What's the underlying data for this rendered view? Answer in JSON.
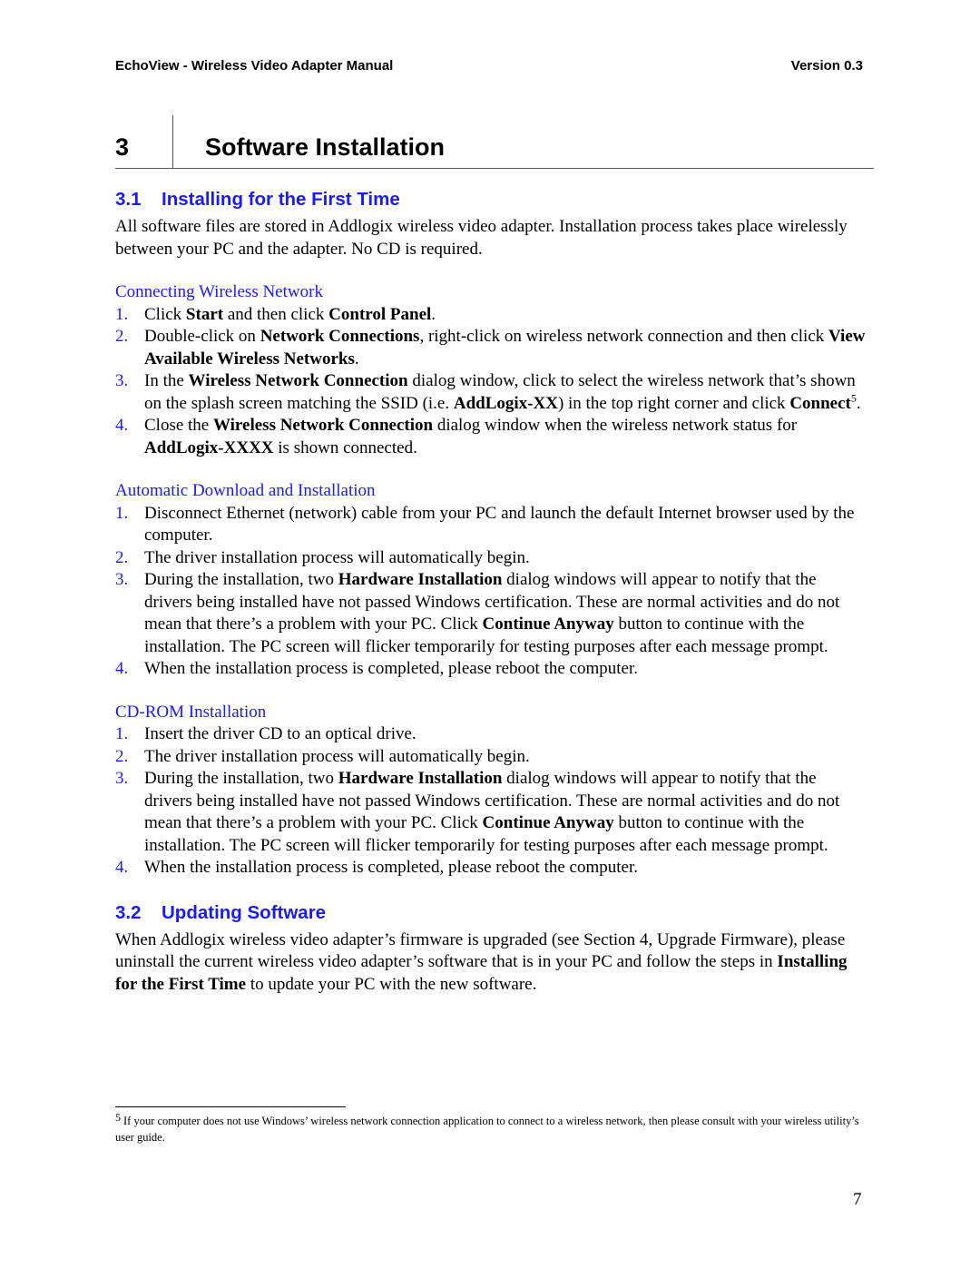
{
  "header": {
    "title": "EchoView - Wireless Video Adapter Manual",
    "version": "Version 0.3"
  },
  "chapter": {
    "number": "3",
    "title": "Software Installation"
  },
  "section1": {
    "number": "3.1",
    "title": "Installing for the First Time",
    "intro": "All software files are stored in Addlogix wireless video adapter.  Installation process takes place wirelessly between your PC and the adapter.  No CD is required.",
    "subsections": [
      {
        "title": "Connecting Wireless Network",
        "items": [
          {
            "num": "1.",
            "parts": [
              [
                "Click ",
                false
              ],
              [
                "Start",
                true
              ],
              [
                " and then click ",
                false
              ],
              [
                "Control Panel",
                true
              ],
              [
                ".",
                false
              ]
            ]
          },
          {
            "num": "2.",
            "parts": [
              [
                "Double-click on ",
                false
              ],
              [
                "Network Connections",
                true
              ],
              [
                ", right-click on wireless network connection and then click ",
                false
              ],
              [
                "View Available Wireless Networks",
                true
              ],
              [
                ".",
                false
              ]
            ]
          },
          {
            "num": "3.",
            "parts": [
              [
                "In the ",
                false
              ],
              [
                "Wireless Network Connection",
                true
              ],
              [
                " dialog window, click to select the wireless network that’s shown on the splash screen matching the SSID (i.e. ",
                false
              ],
              [
                "AddLogix-XX",
                true
              ],
              [
                ") in the top right corner and click ",
                false
              ],
              [
                "Connect",
                true
              ],
              [
                "5",
                "sup"
              ],
              [
                ".",
                false
              ]
            ]
          },
          {
            "num": "4.",
            "parts": [
              [
                "Close the ",
                false
              ],
              [
                "Wireless Network Connection",
                true
              ],
              [
                " dialog window when the wireless network status for ",
                false
              ],
              [
                "AddLogix-XXXX",
                true
              ],
              [
                " is shown connected.",
                false
              ]
            ]
          }
        ]
      },
      {
        "title": "Automatic Download and Installation",
        "items": [
          {
            "num": "1.",
            "parts": [
              [
                "Disconnect Ethernet (network) cable from your PC and launch the default Internet browser used by the computer.",
                false
              ]
            ]
          },
          {
            "num": "2.",
            "parts": [
              [
                "The driver installation process will automatically begin.",
                false
              ]
            ]
          },
          {
            "num": "3.",
            "parts": [
              [
                "During the installation, two ",
                false
              ],
              [
                "Hardware Installation",
                true
              ],
              [
                " dialog windows will appear to notify that the drivers being installed have not passed Windows certification.  These are normal activities and do not mean that there’s a problem with your PC.  Click ",
                false
              ],
              [
                "Continue Anyway",
                true
              ],
              [
                " button to continue with the installation.  The PC screen will flicker temporarily for testing purposes after each message prompt.",
                false
              ]
            ]
          },
          {
            "num": "4.",
            "parts": [
              [
                "When the installation process is completed, please reboot the computer.",
                false
              ]
            ]
          }
        ]
      },
      {
        "title": "CD-ROM Installation",
        "items": [
          {
            "num": "1.",
            "parts": [
              [
                "Insert the driver CD to an optical drive.",
                false
              ]
            ]
          },
          {
            "num": "2.",
            "parts": [
              [
                "The driver installation process will automatically begin.",
                false
              ]
            ]
          },
          {
            "num": "3.",
            "parts": [
              [
                "During the installation, two ",
                false
              ],
              [
                "Hardware Installation",
                true
              ],
              [
                " dialog windows will appear to notify that the drivers being installed have not passed Windows certification.  These are normal activities and do not mean that there’s a problem with your PC.  Click ",
                false
              ],
              [
                "Continue Anyway",
                true
              ],
              [
                " button to continue with the installation.  The PC screen will flicker temporarily for testing purposes after each message prompt.",
                false
              ]
            ]
          },
          {
            "num": "4.",
            "parts": [
              [
                "When the installation process is completed, please reboot the computer.",
                false
              ]
            ]
          }
        ]
      }
    ]
  },
  "section2": {
    "number": "3.2",
    "title": "Updating Software",
    "parts": [
      [
        "When Addlogix wireless video adapter’s firmware is upgraded (see Section 4, Upgrade Firmware), please uninstall the current wireless video adapter’s software that is in your PC and follow the steps in ",
        false
      ],
      [
        "Installing for the First Time",
        true
      ],
      [
        " to update your PC with the new software.",
        false
      ]
    ]
  },
  "footnote": {
    "mark": "5",
    "text": "If your computer does not use Windows’ wireless network connection application to connect to a wireless network, then please consult with your wireless utility’s user guide."
  },
  "page_number": "7",
  "colors": {
    "heading_blue": "#1a1aff"
  }
}
